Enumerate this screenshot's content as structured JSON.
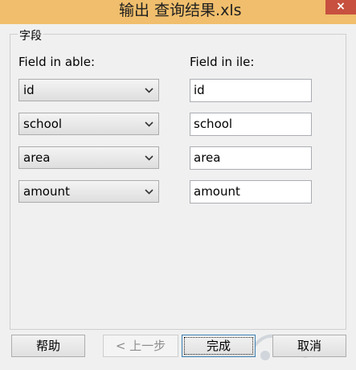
{
  "window": {
    "title": "输出 查询结果.xls",
    "close_glyph": "×"
  },
  "group": {
    "label": "字段"
  },
  "columns": {
    "left_header": "Field in able:",
    "right_header": "Field in ile:"
  },
  "rows": [
    {
      "table_field": "id",
      "file_field": "id"
    },
    {
      "table_field": "school",
      "file_field": "school"
    },
    {
      "table_field": "area",
      "file_field": "area"
    },
    {
      "table_field": "amount",
      "file_field": "amount"
    }
  ],
  "buttons": {
    "help": "帮助",
    "prev": "< 上一步",
    "finish": "完成",
    "cancel": "取消"
  },
  "colors": {
    "titlebar": "#f0be6c",
    "close": "#c7503f",
    "background": "#f0f0f0"
  }
}
